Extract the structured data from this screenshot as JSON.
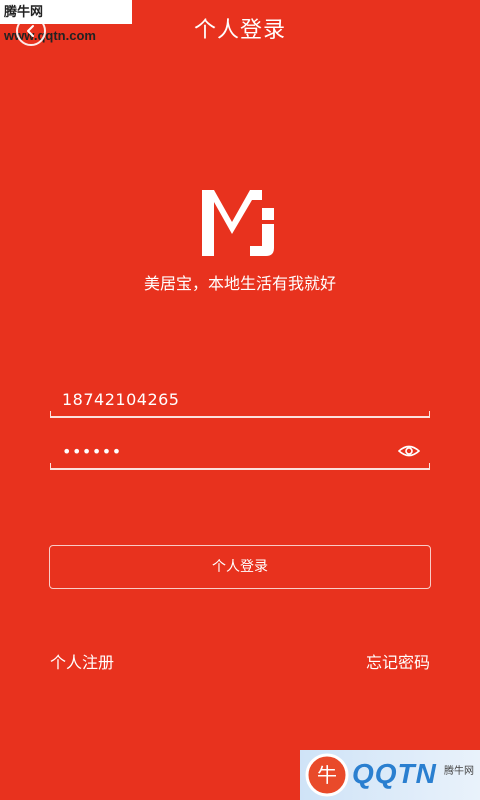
{
  "watermark": {
    "top": "腾牛网 www.qqtn.com",
    "bottom_brand": "QQTN",
    "bottom_label": "腾牛网"
  },
  "header": {
    "back_icon": "chevron-left-icon",
    "title": "个人登录"
  },
  "logo": {
    "text": "MJ"
  },
  "slogan": "美居宝，本地生活有我就好",
  "form": {
    "phone_value": "18742104265",
    "password_value": "••••••",
    "eye_icon": "eye-icon"
  },
  "login_button": "个人登录",
  "links": {
    "register": "个人注册",
    "forgot": "忘记密码"
  },
  "colors": {
    "background": "#e8321e",
    "foreground": "#ffffff"
  }
}
